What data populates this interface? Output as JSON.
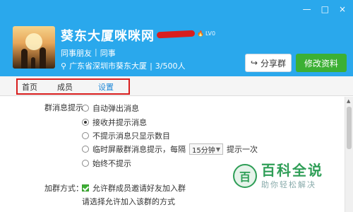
{
  "window": {
    "controls": [
      "—",
      "□",
      "×"
    ]
  },
  "group": {
    "name": "葵东大厦咪咪网",
    "level_badge": "LV0",
    "tags": [
      "同事朋友",
      "同事"
    ],
    "location": "广东省深圳市葵东大厦",
    "members": "3/500人"
  },
  "buttons": {
    "share": "分享群",
    "edit": "修改资料"
  },
  "tabs": [
    "首页",
    "成员",
    "设置"
  ],
  "settings": {
    "message_label": "群消息提示：",
    "message_options": [
      {
        "label": "自动弹出消息",
        "checked": false
      },
      {
        "label": "接收并提示消息",
        "checked": true
      },
      {
        "label": "不提示消息只显示数目",
        "checked": false
      },
      {
        "label": "临时屏蔽群消息提示，每隔",
        "checked": false,
        "select_value": "15分钟",
        "suffix": "提示一次"
      },
      {
        "label": "始终不提示",
        "checked": false
      }
    ],
    "join_label": "加群方式：",
    "join_checkbox": "允许群成员邀请好友加入群",
    "join_note": "请选择允许加入该群的方式"
  },
  "watermark": {
    "logo": "百",
    "title": "百科全说",
    "subtitle": "助你轻松解决"
  }
}
